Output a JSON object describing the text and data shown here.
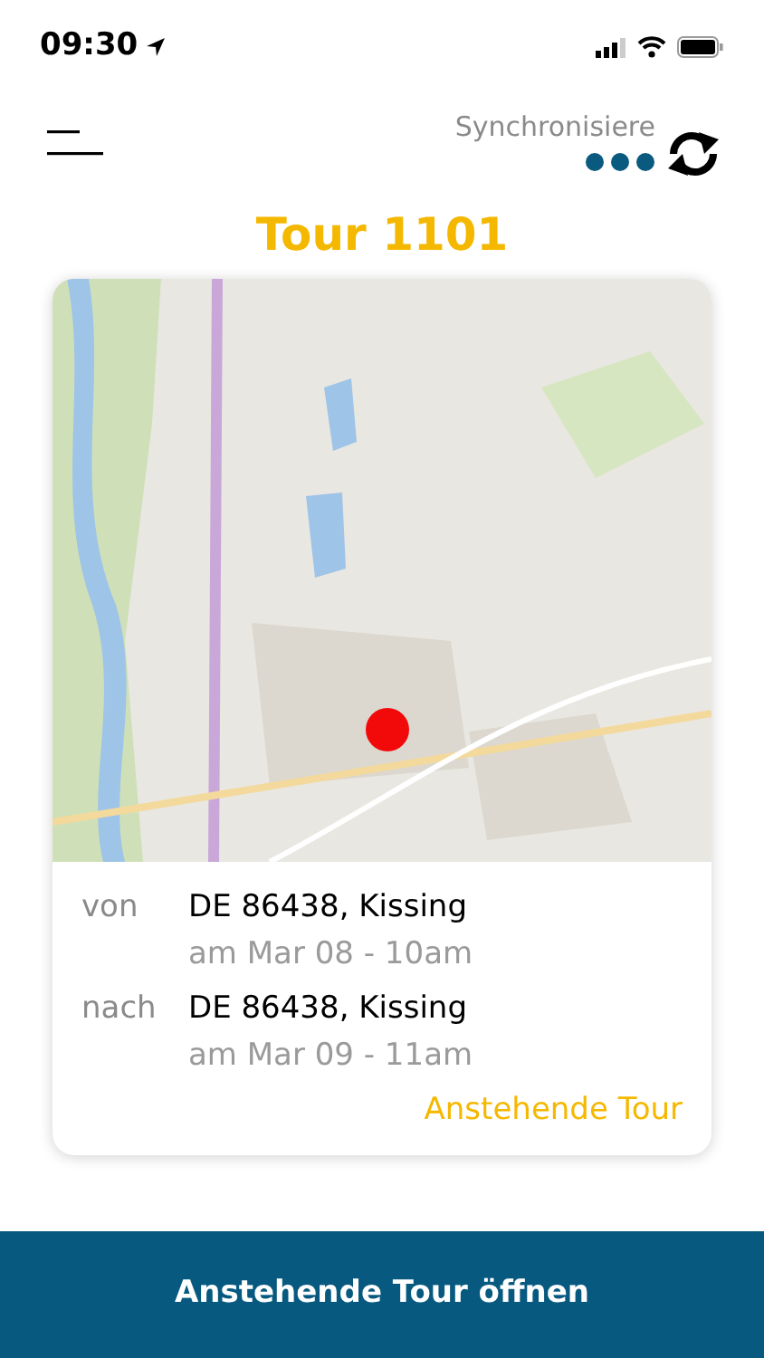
{
  "status_bar": {
    "time": "09:30"
  },
  "header": {
    "sync_label": "Synchronisiere"
  },
  "title": "Tour 1101",
  "card": {
    "stops": [
      {
        "label": "von",
        "address": "DE 86438, Kissing",
        "time": "am Mar 08 - 10am"
      },
      {
        "label": "nach",
        "address": "DE 86438, Kissing",
        "time": "am Mar 09 - 11am"
      }
    ],
    "status": "Anstehende Tour"
  },
  "primary_button": "Anstehende Tour öffnen"
}
